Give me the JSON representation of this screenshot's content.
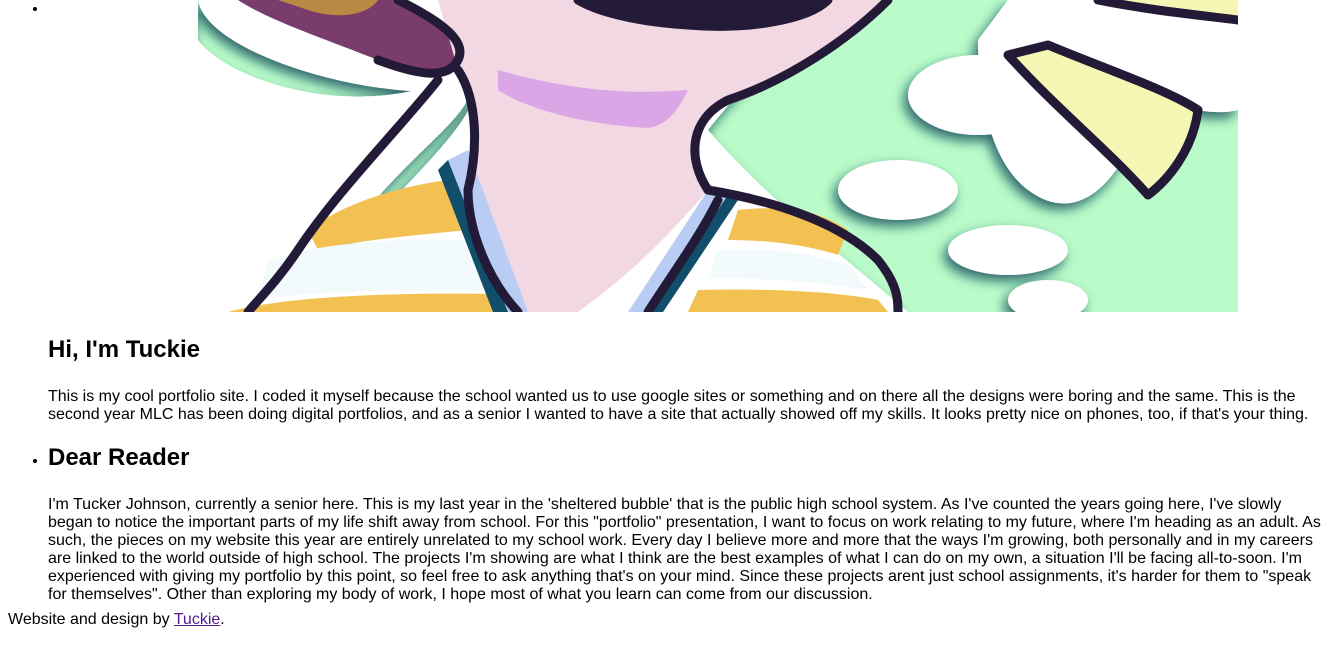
{
  "hero": {
    "image_name": "tuckie-portrait-illustration",
    "colors": {
      "background_green": "#bafcc9",
      "skin_pink": "#f2d8e2",
      "outline_dark": "#231a38",
      "stripe_yellow": "#f2c151",
      "stripe_white": "#f2fafc",
      "collar_blue": "#b9cdf4",
      "collar_dark": "#104e6a",
      "blush_purple": "#dba6e6",
      "hair_purple": "#7a3c6c",
      "hair_tan": "#b98a44",
      "horn_yellow": "#f6f7b5"
    }
  },
  "intro": {
    "title": "Hi, I'm Tuckie",
    "text": "This is my cool portfolio site. I coded it myself because the school wanted us to use google sites or something and on there all the designs were boring and the same. This is the second year MLC has been doing digital portfolios, and as a senior I wanted to have a site that actually showed off my skills. It looks pretty nice on phones, too, if that's your thing."
  },
  "reader": {
    "title": "Dear Reader",
    "text": "I'm Tucker Johnson, currently a senior here. This is my last year in the 'sheltered bubble' that is the public high school system. As I've counted the years going here, I've slowly began to notice the important parts of my life shift away from school. For this \"portfolio\" presentation, I want to focus on work relating to my future, where I'm heading as an adult. As such, the pieces on my website this year are entirely unrelated to my school work. Every day I believe more and more that the ways I'm growing, both personally and in my careers are linked to the world outside of high school. The projects I'm showing are what I think are the best examples of what I can do on my own, a situation I'll be facing all-to-soon. I'm experienced with giving my portfolio by this point, so feel free to ask anything that's on your mind. Since these projects arent just school assignments, it's harder for them to \"speak for themselves\". Other than exploring my body of work, I hope most of what you learn can come from our discussion."
  },
  "footer": {
    "prefix": "Website and design by ",
    "link_text": "Tuckie",
    "suffix": "."
  }
}
